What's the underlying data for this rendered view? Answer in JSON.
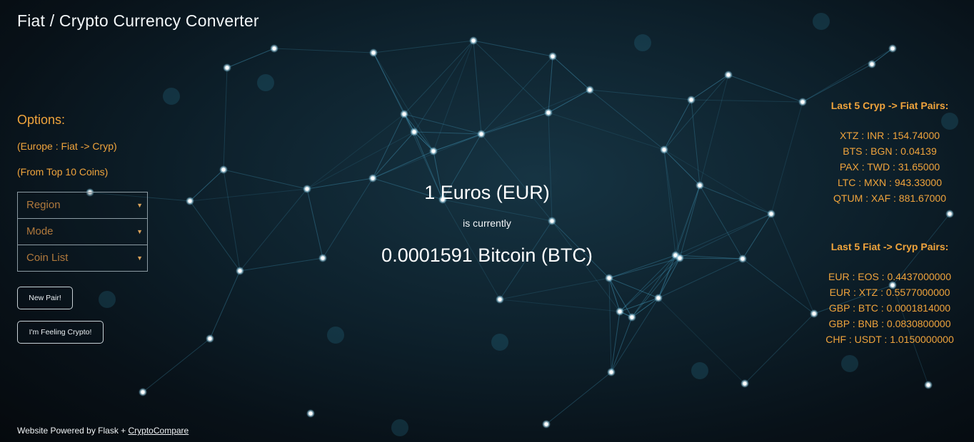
{
  "header": {
    "title": "Fiat / Crypto Currency Converter"
  },
  "options": {
    "heading": "Options:",
    "line1": "(Europe : Fiat -> Cryp)",
    "line2": "(From Top 10 Coins)",
    "selects": [
      {
        "placeholder": "Region"
      },
      {
        "placeholder": "Mode"
      },
      {
        "placeholder": "Coin List"
      }
    ],
    "buttons": {
      "new_pair": "New Pair!",
      "feeling_crypto": "I'm Feeling Crypto!"
    }
  },
  "result": {
    "amount_line": "1 Euros (EUR)",
    "mid_line": "is currently",
    "result_line": "0.0001591 Bitcoin (BTC)"
  },
  "crypto_to_fiat": {
    "heading": "Last 5 Cryp -> Fiat Pairs:",
    "items": [
      "XTZ : INR : 154.74000",
      "BTS : BGN : 0.04139",
      "PAX : TWD : 31.65000",
      "LTC : MXN : 943.33000",
      "QTUM : XAF : 881.67000"
    ]
  },
  "fiat_to_crypto": {
    "heading": "Last 5 Fiat -> Cryp Pairs:",
    "items": [
      "EUR : EOS : 0.4437000000",
      "EUR : XTZ : 0.5577000000",
      "GBP : BTC : 0.0001814000",
      "GBP : BNB : 0.0830800000",
      "CHF : USDT : 1.0150000000"
    ]
  },
  "footer": {
    "text": "Website Powered by Flask + ",
    "link": "CryptoCompare"
  },
  "colors": {
    "accent": "#f0a43c",
    "background": "#0d202b",
    "network_line": "#4fb3d9"
  },
  "icons": {
    "dropdown": "caret-down-icon",
    "background": "network-graph-background"
  }
}
